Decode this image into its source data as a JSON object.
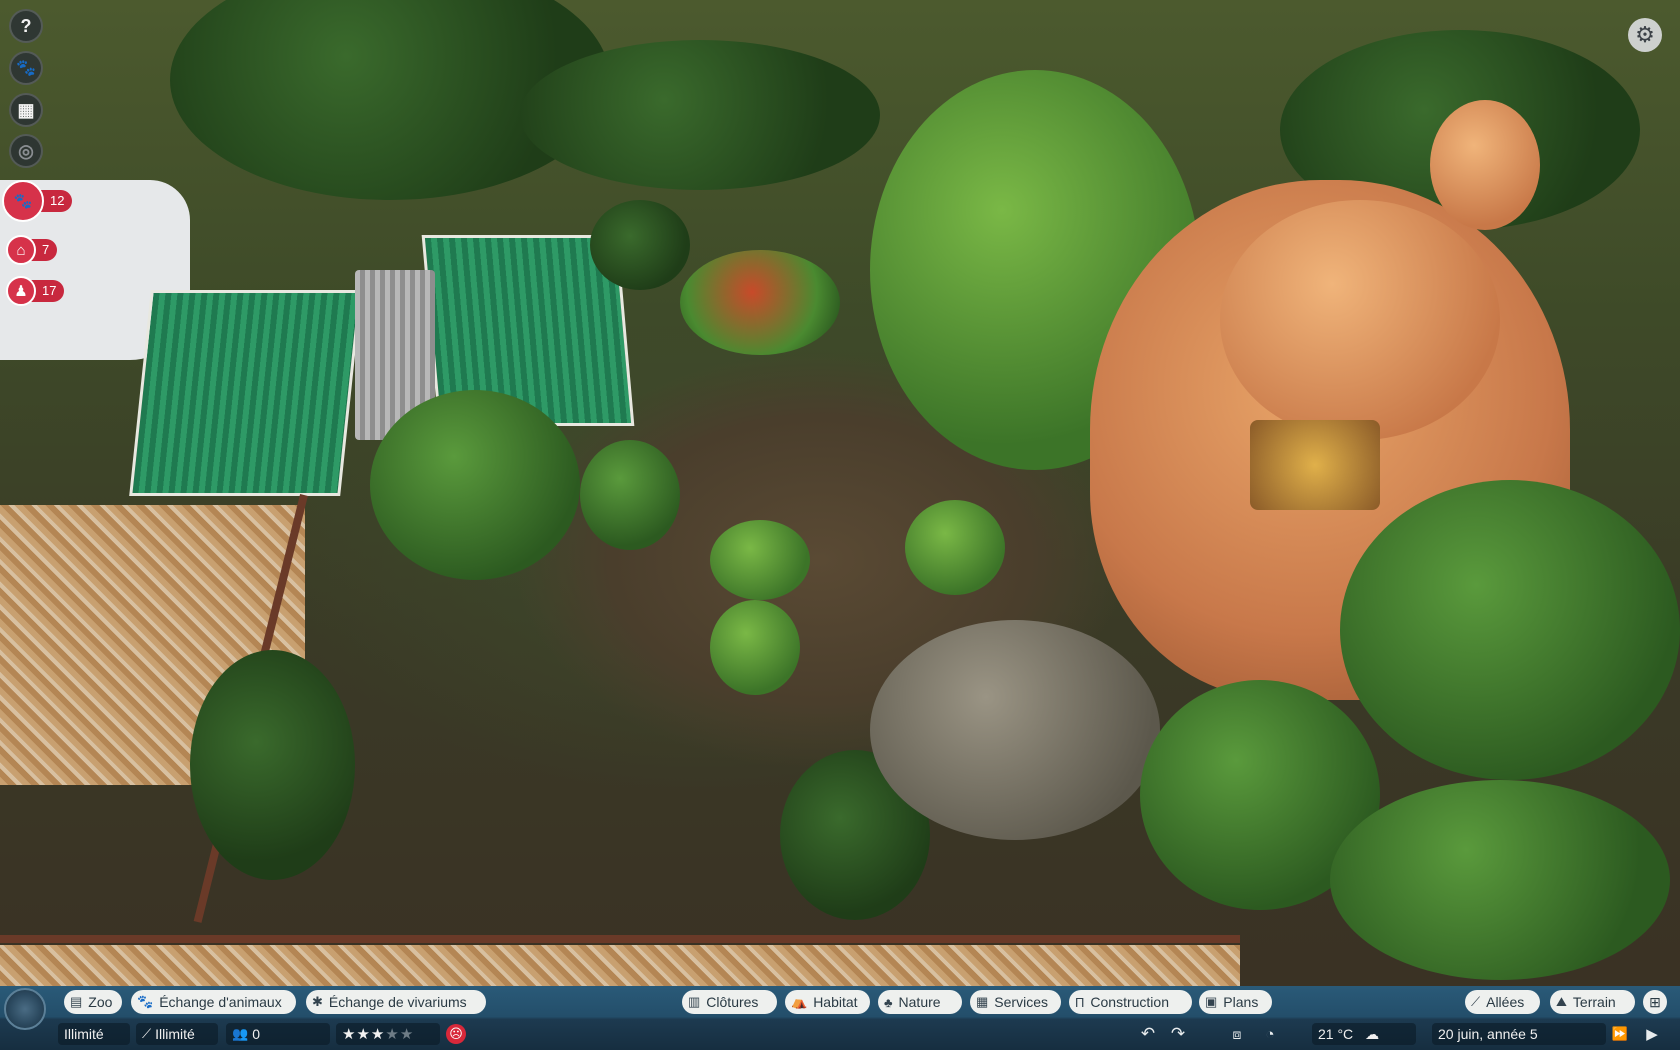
{
  "left_toolbar": {
    "buttons": [
      {
        "icon": "help-icon",
        "glyph": "?"
      },
      {
        "icon": "animal-book-icon",
        "glyph": "🐾"
      },
      {
        "icon": "calendar-icon",
        "glyph": "▦"
      },
      {
        "icon": "camera-icon",
        "glyph": "◎"
      }
    ],
    "counters": [
      {
        "icon": "paw-icon",
        "glyph": "🐾",
        "value": "12"
      },
      {
        "icon": "facility-icon",
        "glyph": "⌂",
        "value": "7"
      },
      {
        "icon": "staff-icon",
        "glyph": "♟",
        "value": "17"
      }
    ]
  },
  "settings": {
    "icon": "gear-icon",
    "glyph": "⚙"
  },
  "bottom_tabs_left": [
    {
      "label": "Zoo",
      "icon": "zoo-icon",
      "glyph": "▤"
    },
    {
      "label": "Échange d'animaux",
      "icon": "paw-icon",
      "glyph": "🐾"
    },
    {
      "label": "Échange de vivariums",
      "icon": "bug-icon",
      "glyph": "✱"
    }
  ],
  "bottom_tabs_center": [
    {
      "label": "Clôtures",
      "icon": "fence-icon",
      "glyph": "▥"
    },
    {
      "label": "Habitat",
      "icon": "habitat-icon",
      "glyph": "⛺"
    },
    {
      "label": "Nature",
      "icon": "tree-icon",
      "glyph": "♣"
    },
    {
      "label": "Services",
      "icon": "shop-icon",
      "glyph": "▦"
    },
    {
      "label": "Construction",
      "icon": "pillar-icon",
      "glyph": "Π"
    },
    {
      "label": "Plans",
      "icon": "blueprint-icon",
      "glyph": "▣"
    }
  ],
  "bottom_tabs_right": [
    {
      "label": "Allées",
      "icon": "path-icon",
      "glyph": "⟋"
    },
    {
      "label": "Terrain",
      "icon": "terrain-icon",
      "glyph": "⛰"
    }
  ],
  "extra_tab": {
    "icon": "grid-icon",
    "glyph": "⊞"
  },
  "status": {
    "money": "Illimité",
    "research": "Illimité",
    "research_icon": "flask-icon",
    "guests": "0",
    "guests_icon": "guests-icon",
    "rating_stars": 3,
    "rating_max": 5,
    "mood_icon": "sad-face-icon",
    "temperature": "21 °C",
    "weather_icon": "cloud-icon",
    "date": "20 juin, année 5"
  },
  "controls": {
    "undo": "↶",
    "redo": "↷",
    "pause": "▶",
    "fast_forward": "⏩"
  }
}
